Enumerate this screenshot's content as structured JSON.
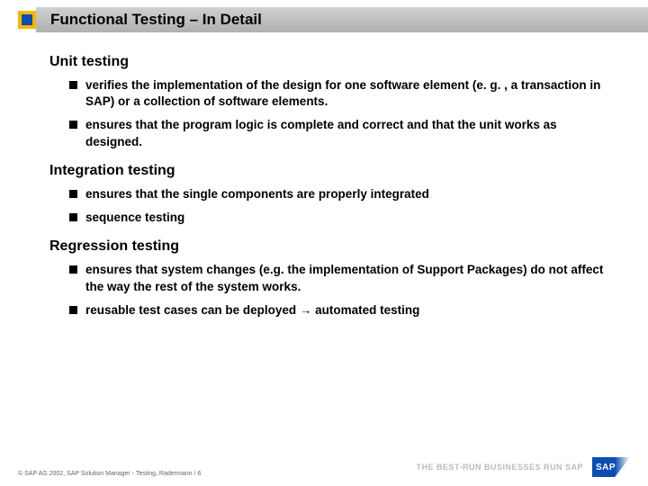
{
  "slide": {
    "title": "Functional Testing – In Detail",
    "sections": [
      {
        "heading": "Unit testing",
        "bullets": [
          "verifies the implementation of the design for one software element (e. g. , a transaction in SAP) or a collection of software elements.",
          "ensures that the program logic is complete and correct and that the unit works as designed."
        ]
      },
      {
        "heading": "Integration testing",
        "bullets": [
          "ensures that the single components are properly integrated",
          "sequence testing"
        ]
      },
      {
        "heading": "Regression testing",
        "bullets": [
          "ensures that system changes (e.g. the implementation of Support Packages) do not affect the way the rest of the system works.",
          "reusable test cases can be deployed → automated testing"
        ]
      }
    ]
  },
  "footer": {
    "copyright": "© SAP AG 2002, SAP Solution Manager - Testing, Radermann / 6",
    "tagline": "THE BEST-RUN BUSINESSES RUN SAP",
    "logo_text": "SAP"
  },
  "colors": {
    "accent": "#f5b800",
    "title_bar": "#b8b8b8"
  }
}
